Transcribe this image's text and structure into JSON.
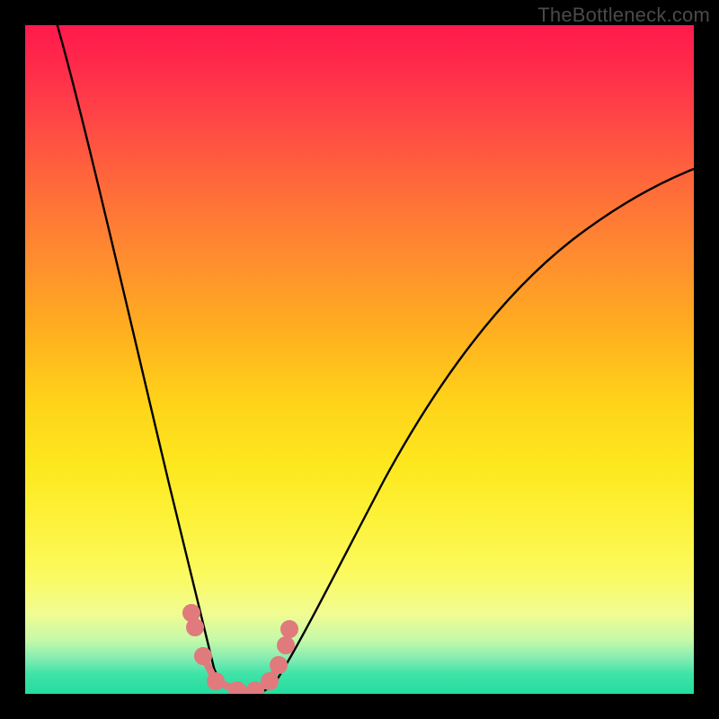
{
  "watermark": "TheBottleneck.com",
  "chart_data": {
    "type": "line",
    "title": "",
    "xlabel": "",
    "ylabel": "",
    "xlim": [
      0,
      100
    ],
    "ylim": [
      0,
      100
    ],
    "grid": "off",
    "legend": "none",
    "background_gradient": {
      "top": "#ff1a4d",
      "mid": "#ffd21a",
      "bottom": "#25dc9f",
      "meaning": "top=red=high bottleneck, bottom=green=optimal"
    },
    "series": [
      {
        "name": "bottleneck-curve",
        "color": "#000000",
        "x": [
          4,
          8,
          12,
          16,
          20,
          24,
          26,
          28,
          30,
          32,
          36,
          40,
          46,
          54,
          62,
          70,
          80,
          90,
          100
        ],
        "y": [
          100,
          82,
          65,
          48,
          32,
          14,
          6,
          1,
          0,
          0,
          1,
          4,
          12,
          26,
          40,
          52,
          63,
          72,
          78
        ],
        "note": "Black curve drops steeply from upper-left to a minimum near x≈30, then rises toward upper-right; values are estimated from the plot."
      },
      {
        "name": "marker-points",
        "color": "#e07a7d",
        "style": "dots+segments",
        "x": [
          24.0,
          24.5,
          26.0,
          28.0,
          30.5,
          32.5,
          33.5,
          35.0,
          35.5
        ],
        "y": [
          12.0,
          9.5,
          4.0,
          1.0,
          0.5,
          0.8,
          1.5,
          6.0,
          9.0
        ],
        "note": "Cluster of pale-red dots on and near the curve around the minimum, forming a small U."
      }
    ]
  },
  "colors": {
    "curve": "#000000",
    "markers": "#e07a7d",
    "frame": "#000000"
  }
}
